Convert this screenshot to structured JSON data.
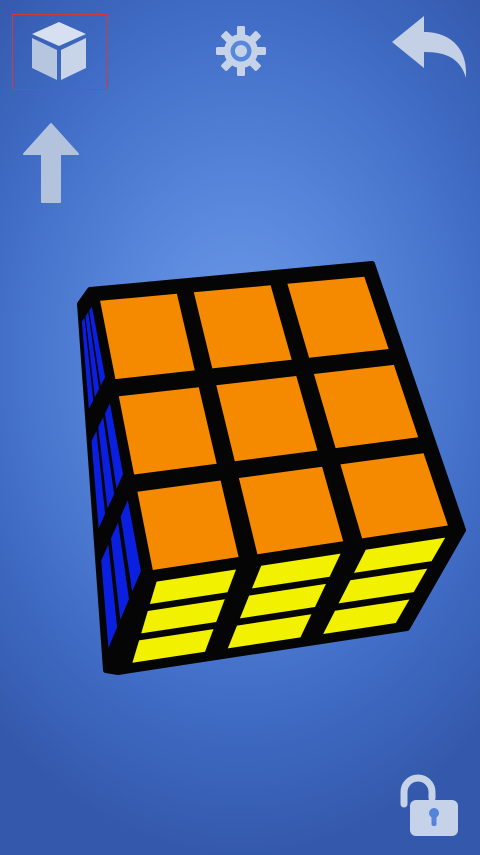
{
  "toolbar": {
    "view_mode": {
      "icon": "cube-view-icon",
      "selected": true
    },
    "settings": {
      "icon": "gear-icon"
    },
    "undo": {
      "icon": "undo-arrow-icon"
    },
    "rotate_up": {
      "icon": "arrow-up-icon"
    },
    "lock": {
      "icon": "unlocked-padlock-icon"
    }
  },
  "cube": {
    "size": 3,
    "faces": {
      "top": [
        "orange",
        "orange",
        "orange",
        "orange",
        "orange",
        "orange",
        "orange",
        "orange",
        "orange"
      ],
      "left": [
        "blue",
        "blue",
        "blue",
        "blue",
        "blue",
        "blue",
        "blue",
        "blue",
        "blue"
      ],
      "front": [
        "yellow",
        "yellow",
        "yellow",
        "yellow",
        "yellow",
        "yellow",
        "yellow",
        "yellow",
        "yellow"
      ]
    }
  },
  "colors": {
    "background": "#5583d9",
    "icon": "#c3d0e6",
    "selection_border": "#d23a3a",
    "orange": "#f58a00",
    "blue": "#0a1fe0",
    "yellow": "#f2f200",
    "cube_body": "#050505"
  }
}
